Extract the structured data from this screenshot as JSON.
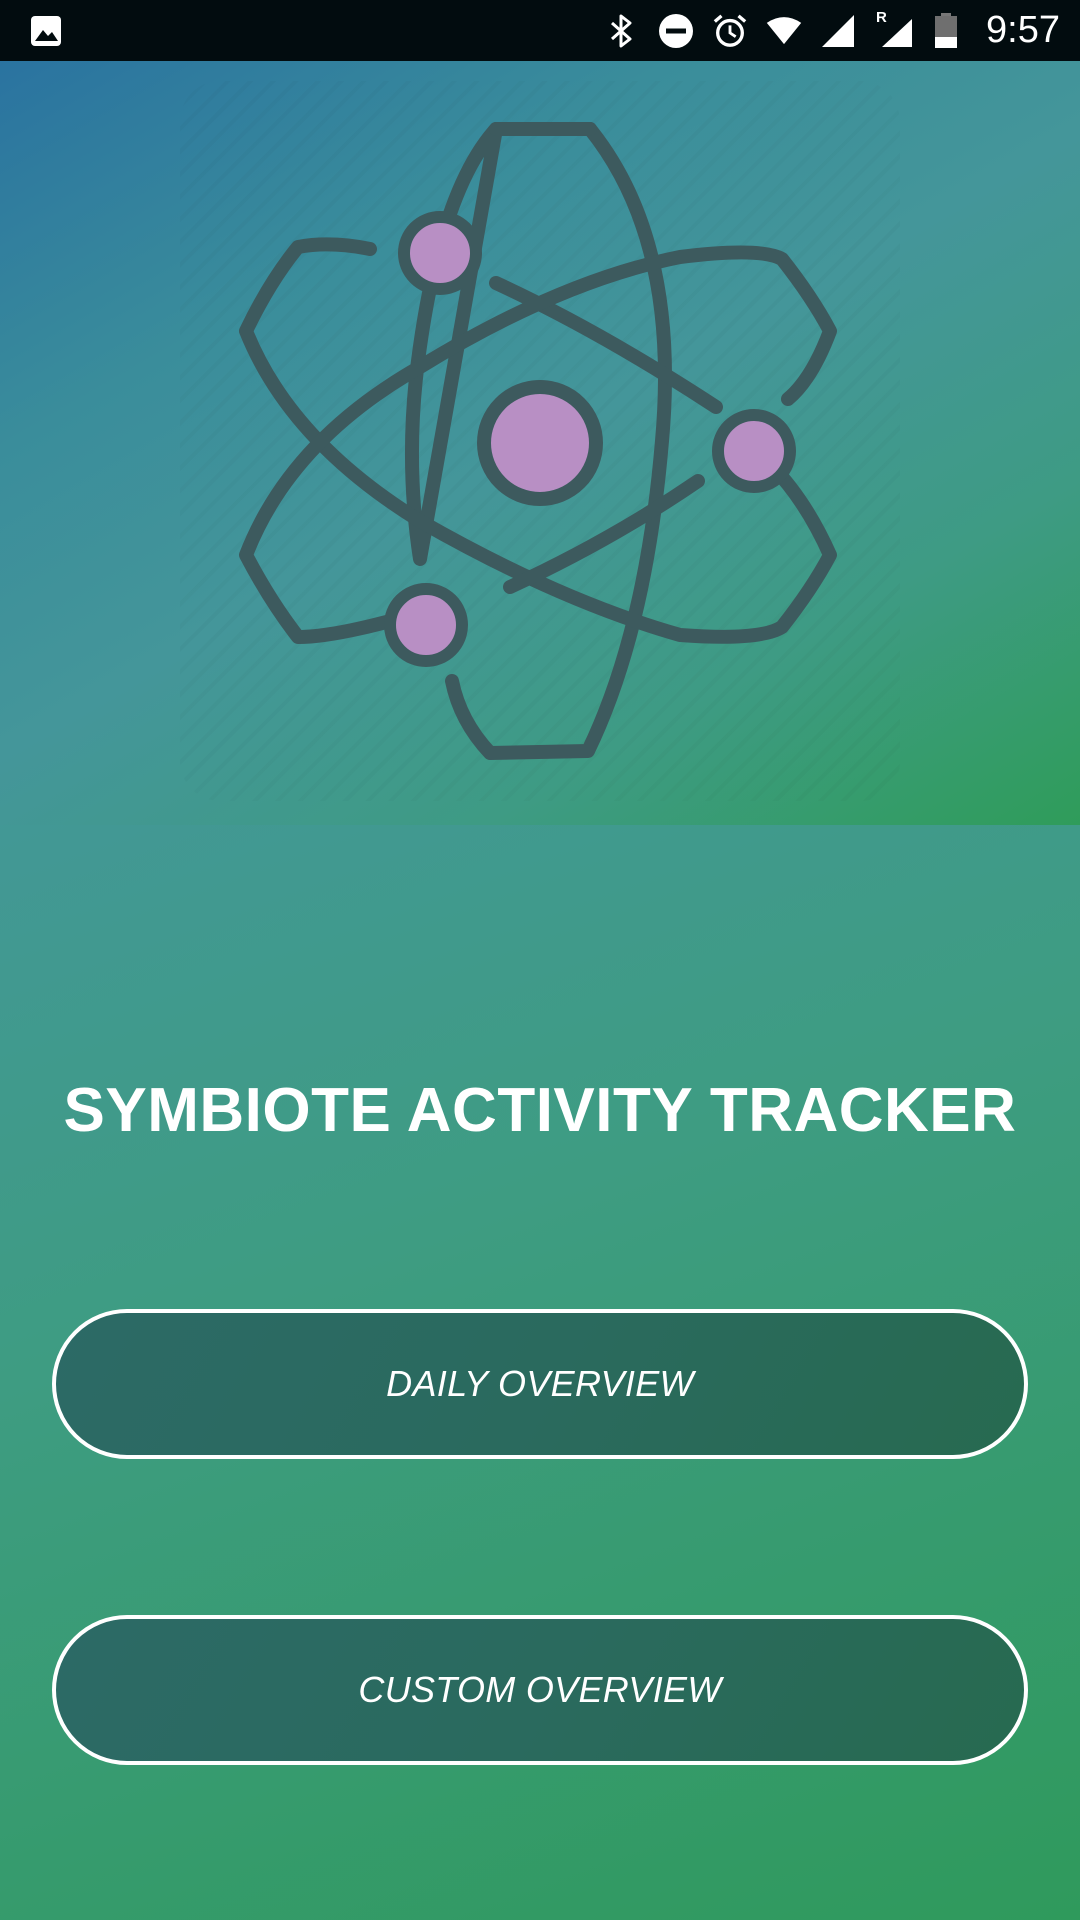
{
  "status_bar": {
    "time": "9:57",
    "roaming_indicator": "R",
    "icons": [
      "gallery-icon",
      "bluetooth-icon",
      "do-not-disturb-icon",
      "alarm-icon",
      "wifi-icon",
      "signal-icon",
      "roaming-signal-icon",
      "battery-icon"
    ]
  },
  "hero": {
    "logo_icon": "atom-icon",
    "colors": {
      "orbit": "#3d5a5e",
      "nucleus": "#b88fc4"
    }
  },
  "title": "SYMBIOTE ACTIVITY TRACKER",
  "buttons": {
    "daily": "DAILY OVERVIEW",
    "custom": "CUSTOM OVERVIEW"
  },
  "colors": {
    "status_bar_bg": "#020c0f",
    "button_fill": "#2a6a5e",
    "button_border": "#ffffff",
    "text": "#ffffff"
  }
}
